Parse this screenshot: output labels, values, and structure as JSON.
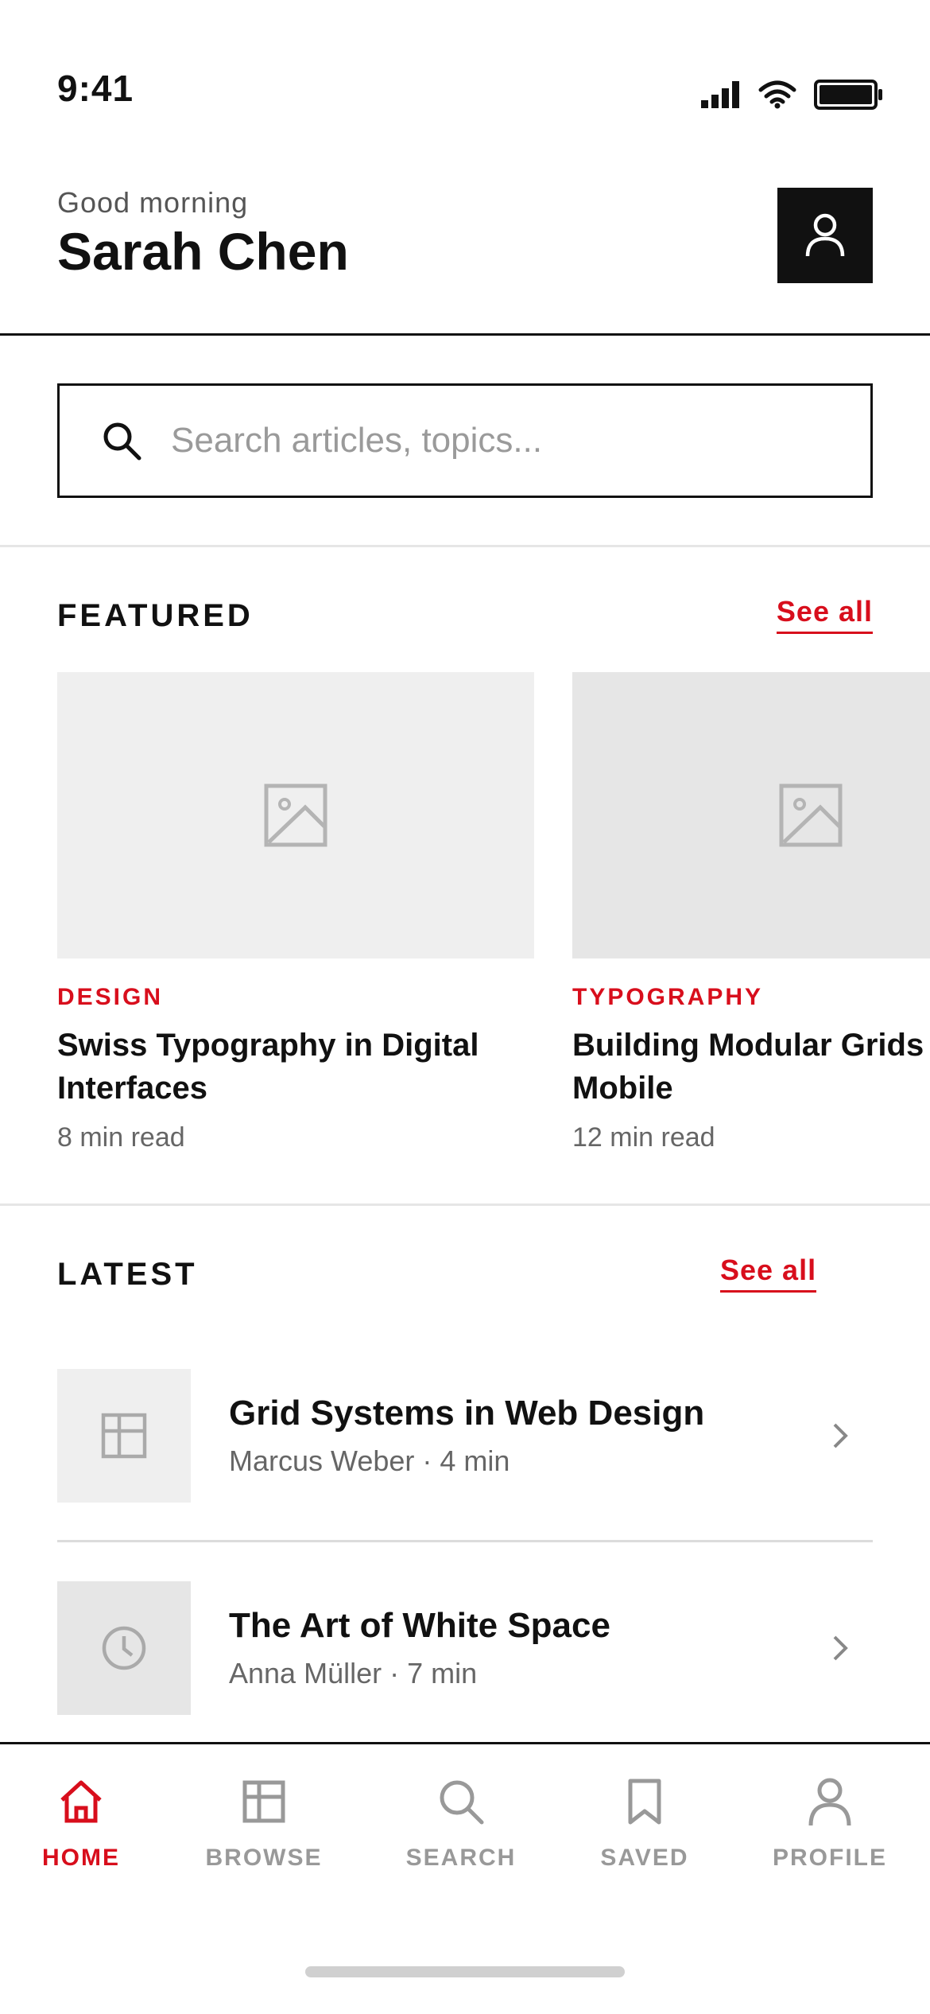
{
  "status_bar": {
    "time": "9:41"
  },
  "header": {
    "greeting": "Good morning",
    "user_name": "Sarah Chen"
  },
  "search": {
    "placeholder": "Search articles, topics..."
  },
  "featured": {
    "title": "FEATURED",
    "see_all": "See all",
    "cards": [
      {
        "category": "DESIGN",
        "title": "Swiss Typography in Digital Interfaces",
        "meta": "8 min read",
        "image_icon": "image-placeholder-icon"
      },
      {
        "category": "TYPOGRAPHY",
        "title": "Building Modular Grids for Mobile",
        "meta": "12 min read",
        "image_icon": "image-placeholder-icon"
      }
    ]
  },
  "latest": {
    "title": "LATEST",
    "see_all": "See all",
    "items": [
      {
        "title": "Grid Systems in Web Design",
        "meta": "Marcus Weber · 4 min",
        "icon": "grid-icon"
      },
      {
        "title": "The Art of White Space",
        "meta": "Anna Müller · 7 min",
        "icon": "clock-icon"
      }
    ]
  },
  "tabs": [
    {
      "label": "HOME",
      "icon": "home-icon",
      "active": true
    },
    {
      "label": "BROWSE",
      "icon": "grid-icon",
      "active": false
    },
    {
      "label": "SEARCH",
      "icon": "search-icon",
      "active": false
    },
    {
      "label": "SAVED",
      "icon": "bookmark-icon",
      "active": false
    },
    {
      "label": "PROFILE",
      "icon": "person-icon",
      "active": false
    }
  ],
  "colors": {
    "accent": "#d80e1c",
    "text": "#111111",
    "muted": "#999999"
  }
}
